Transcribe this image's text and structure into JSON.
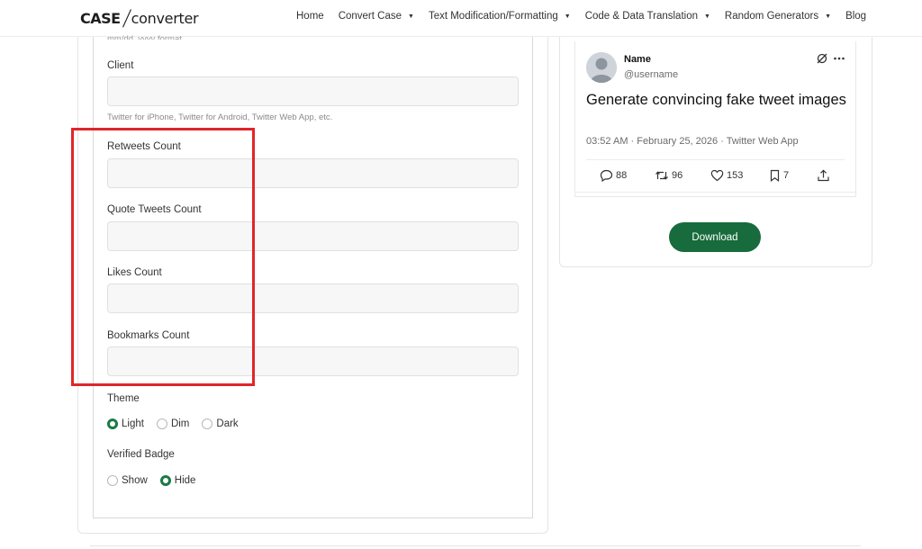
{
  "logo": {
    "part1": "CASE",
    "slash": "/",
    "part2": "converter"
  },
  "nav": [
    {
      "label": "Home",
      "dropdown": false
    },
    {
      "label": "Convert Case",
      "dropdown": true
    },
    {
      "label": "Text Modification/Formatting",
      "dropdown": true
    },
    {
      "label": "Code & Data Translation",
      "dropdown": true
    },
    {
      "label": "Random Generators",
      "dropdown": true
    },
    {
      "label": "Blog",
      "dropdown": false
    }
  ],
  "form": {
    "date_hint": "mm/dd, yyyy format",
    "client": {
      "label": "Client",
      "value": "",
      "help": "Twitter for iPhone, Twitter for Android, Twitter Web App, etc."
    },
    "retweets": {
      "label": "Retweets Count",
      "value": ""
    },
    "quote_tweets": {
      "label": "Quote Tweets Count",
      "value": ""
    },
    "likes": {
      "label": "Likes Count",
      "value": ""
    },
    "bookmarks": {
      "label": "Bookmarks Count",
      "value": ""
    },
    "theme": {
      "label": "Theme",
      "options": [
        "Light",
        "Dim",
        "Dark"
      ],
      "selected": "Light"
    },
    "verified": {
      "label": "Verified Badge",
      "options": [
        "Show",
        "Hide"
      ],
      "selected": "Hide"
    }
  },
  "tweet": {
    "name": "Name",
    "username": "@username",
    "text": "Generate convincing fake tweet images",
    "meta": "03:52 AM · February 25, 2026 · Twitter Web App",
    "replies": "88",
    "retweets": "96",
    "likes": "153",
    "bookmarks": "7"
  },
  "download_label": "Download",
  "colors": {
    "accent": "#176b3c",
    "highlight": "#e0262a"
  }
}
